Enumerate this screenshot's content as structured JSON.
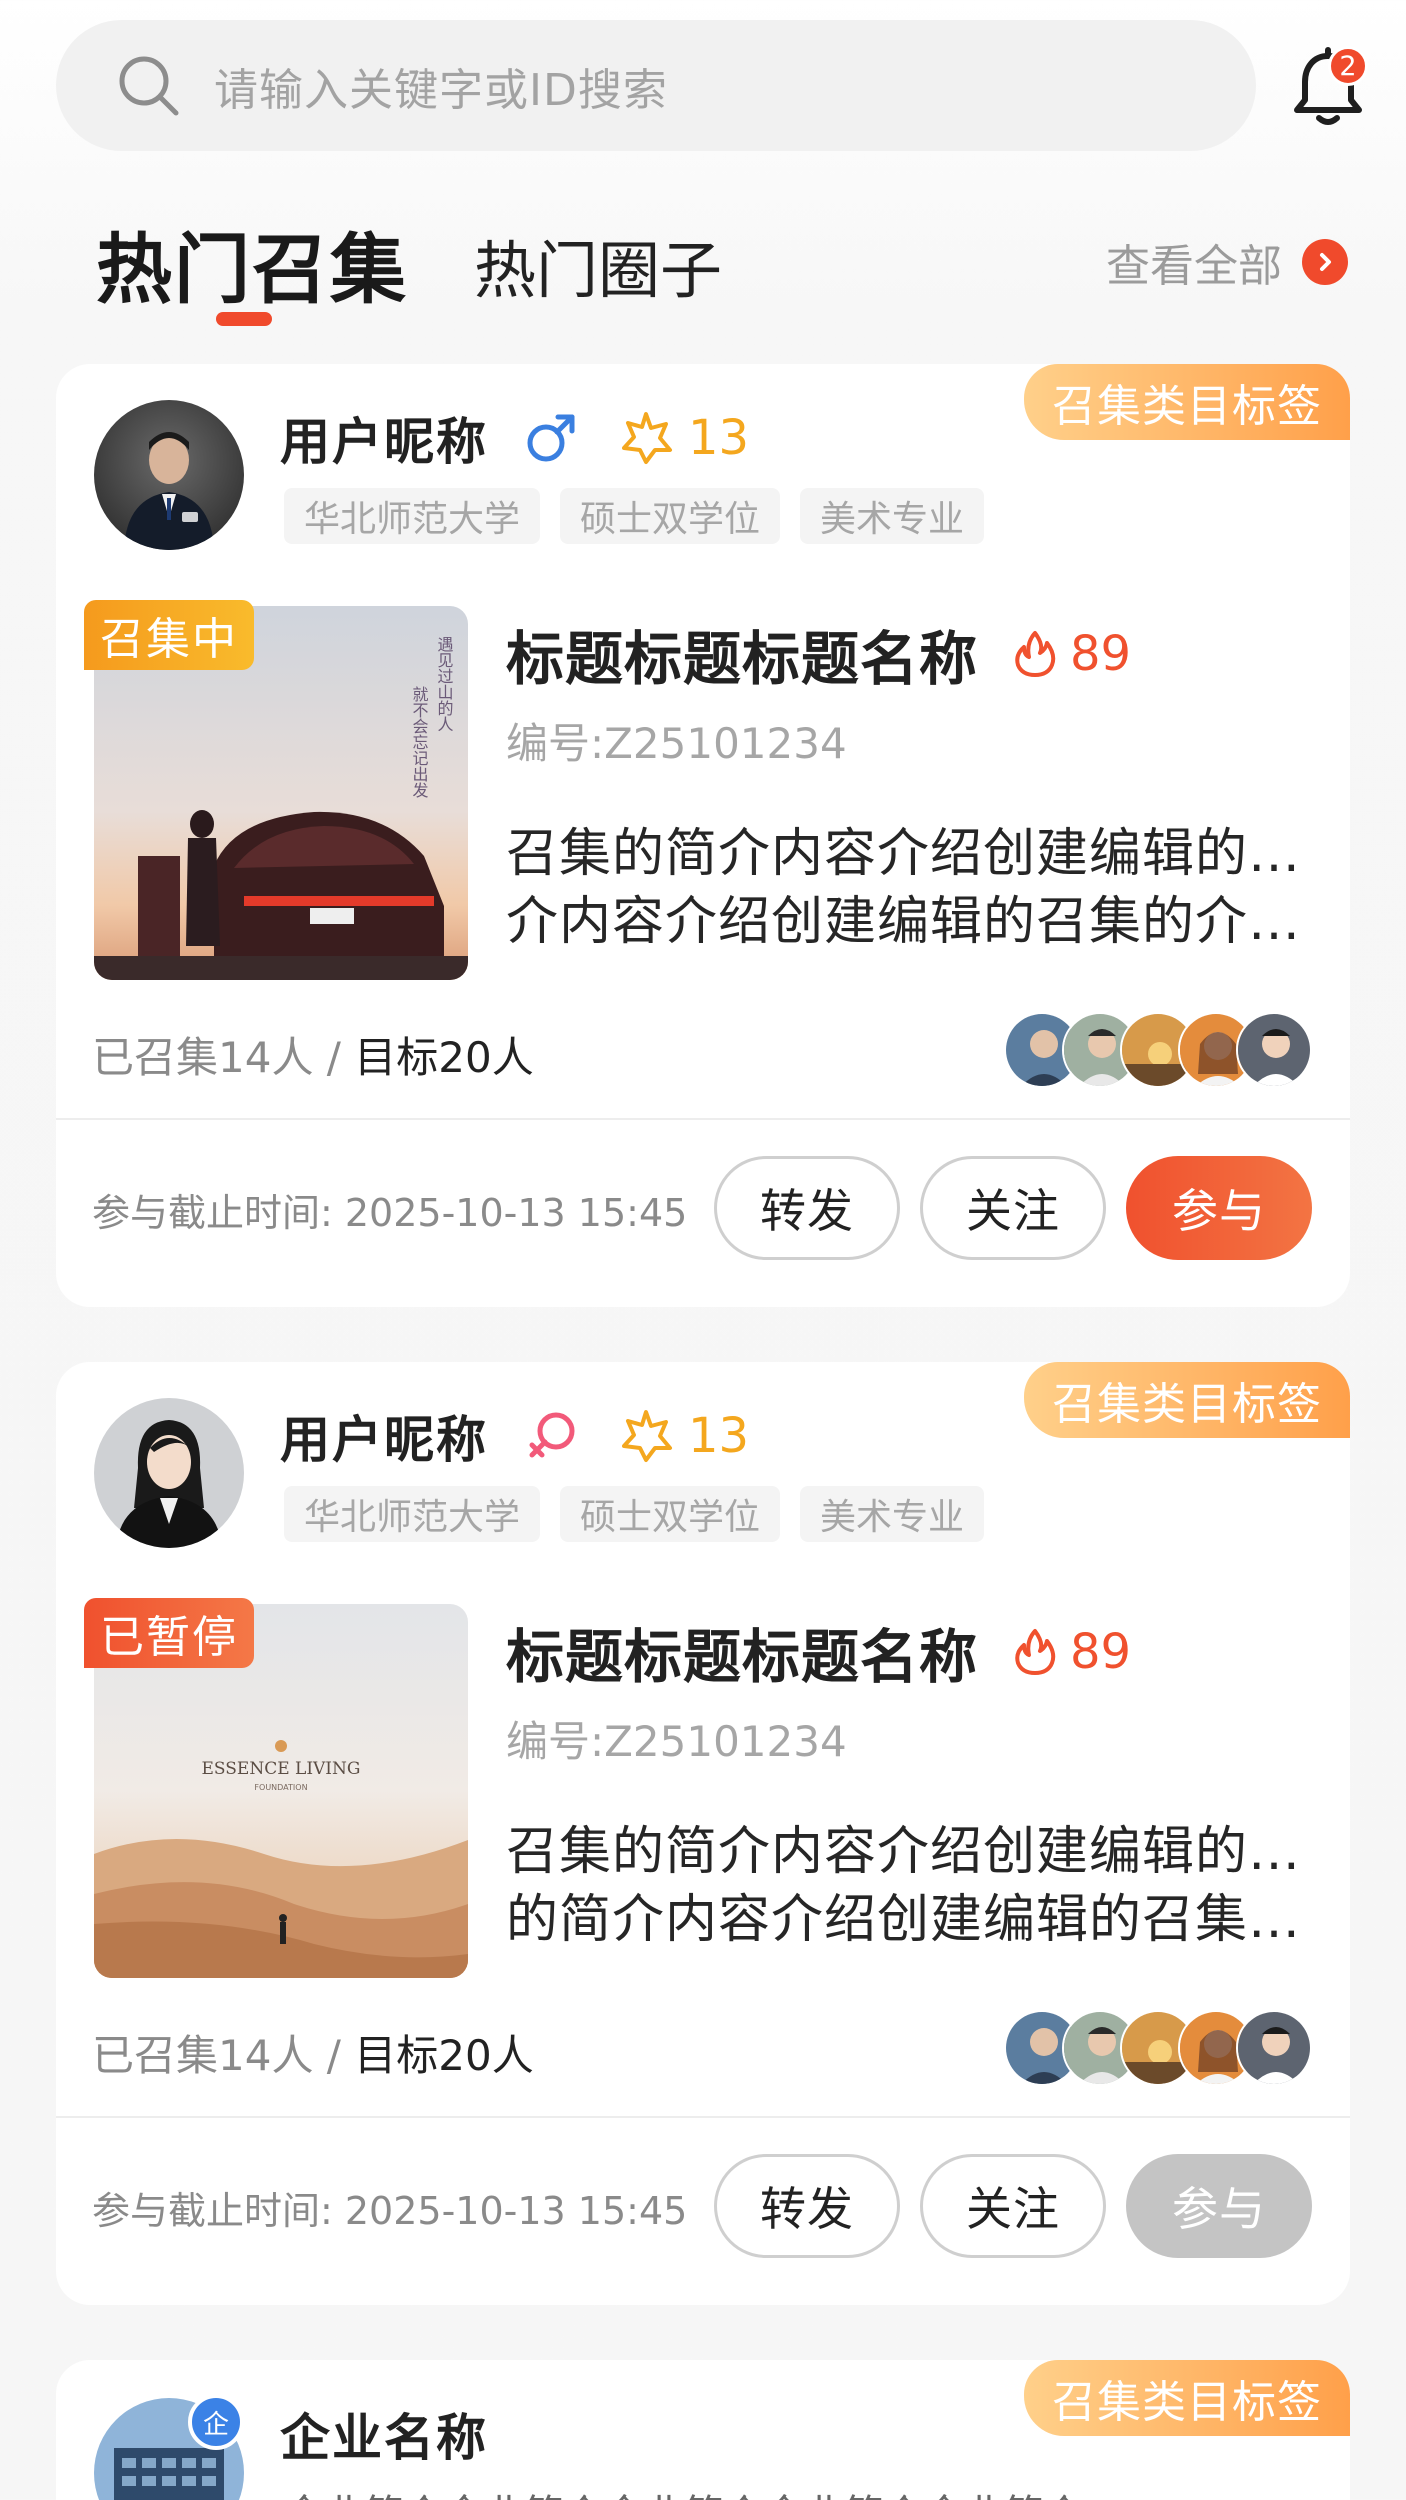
{
  "search": {
    "placeholder": "请输入关键字或ID搜索"
  },
  "notifications": {
    "count": "2"
  },
  "tabs": {
    "active": "热门召集",
    "inactive": "热门圈子",
    "view_all": "查看全部"
  },
  "cards": [
    {
      "category": "召集类目标签",
      "user": {
        "nickname": "用户昵称",
        "gender": "male",
        "badge_count": "13",
        "tags": [
          "华北师范大学",
          "硕士双学位",
          "美术专业"
        ]
      },
      "status": "召集中",
      "title": "标题标题标题名称",
      "heat": "89",
      "code": "编号:Z25101234",
      "intro_lines": [
        "召集的简介内容介绍创建编辑的召集",
        "介内容介绍创建编辑的召集的介内..."
      ],
      "progress_joined": "已召集14人 / ",
      "progress_target": "目标20人",
      "deadline": "参与截止时间: 2025-10-13 15:45",
      "buttons": {
        "forward": "转发",
        "follow": "关注",
        "join": "参与"
      },
      "join_enabled": true
    },
    {
      "category": "召集类目标签",
      "user": {
        "nickname": "用户昵称",
        "gender": "female",
        "badge_count": "13",
        "tags": [
          "华北师范大学",
          "硕士双学位",
          "美术专业"
        ]
      },
      "status": "已暂停",
      "title": "标题标题标题名称",
      "heat": "89",
      "code": "编号:Z25101234",
      "intro_lines": [
        "召集的简介内容介绍创建编辑的召集",
        "的简介内容介绍创建编辑的召集的..."
      ],
      "progress_joined": "已召集14人 / ",
      "progress_target": "目标20人",
      "deadline": "参与截止时间: 2025-10-13 15:45",
      "buttons": {
        "forward": "转发",
        "follow": "关注",
        "join": "参与"
      },
      "join_enabled": false
    },
    {
      "category": "召集类目标签",
      "company": {
        "name": "企业名称",
        "badge": "企",
        "intro": "企业简介企业简介企业简介企业简介企业简介"
      }
    }
  ],
  "colors": {
    "accent": "#f04a2c",
    "gold": "#f4a71e",
    "male": "#3a7fe0",
    "female": "#f25a7a"
  }
}
